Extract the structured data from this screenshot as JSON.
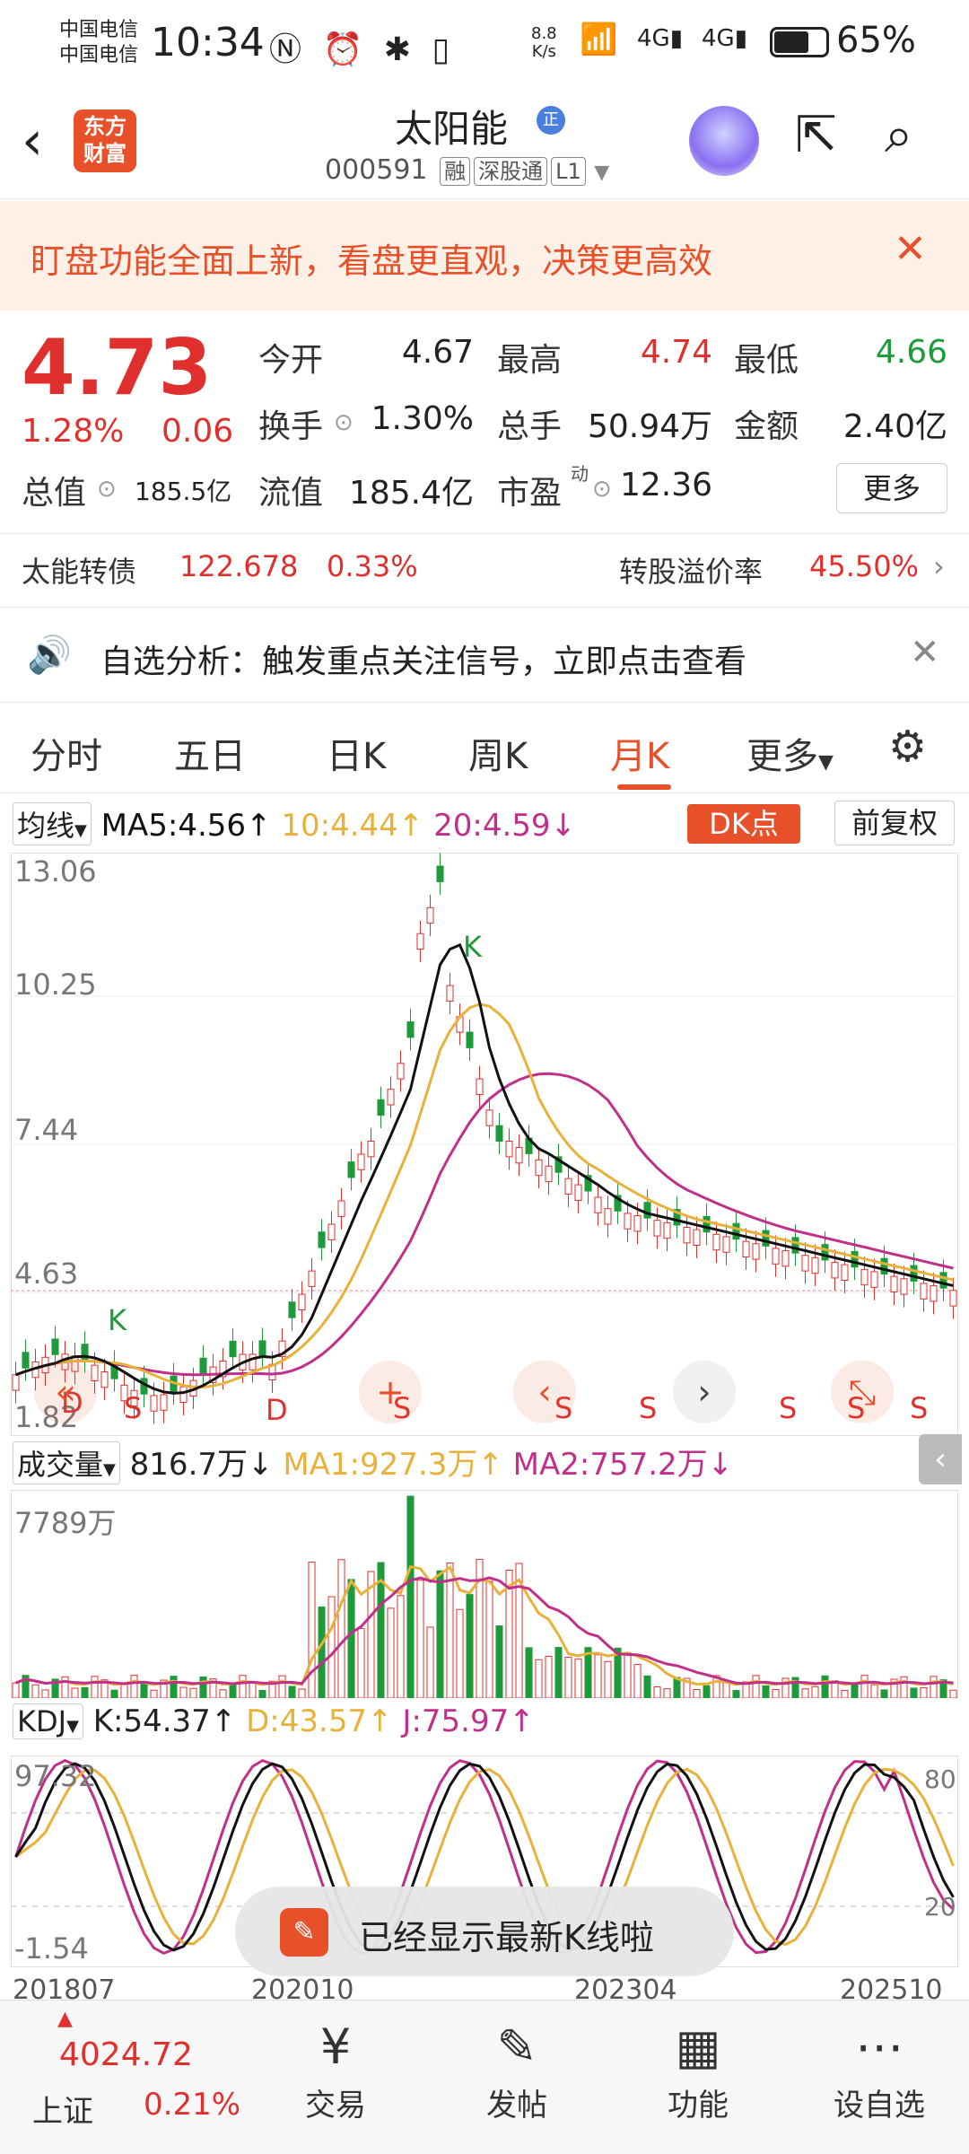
{
  "status": {
    "carrier1": "中国电信",
    "carrier2": "中国电信",
    "time": "10:34",
    "netspeed_value": "8.8",
    "netspeed_unit": "K/s",
    "battery": "65%"
  },
  "nav": {
    "title": "太阳能",
    "zheng": "正",
    "code": "000591",
    "tags": [
      "融",
      "深股通",
      "L1"
    ],
    "logo_line1": "东方",
    "logo_line2": "财富"
  },
  "banner": {
    "text": "盯盘功能全面上新，看盘更直观，决策更高效"
  },
  "quote": {
    "price": "4.73",
    "change_pct": "1.28%",
    "change_amt": "0.06",
    "open_label": "今开",
    "open": "4.67",
    "high_label": "最高",
    "high": "4.74",
    "low_label": "最低",
    "low": "4.66",
    "turnover_label": "换手",
    "turnover": "1.30%",
    "volume_label": "总手",
    "volume": "50.94万",
    "amount_label": "金额",
    "amount": "2.40亿",
    "mktcap_label": "总值",
    "mktcap": "185.5亿",
    "float_label": "流值",
    "float": "185.4亿",
    "pe_label": "市盈",
    "pe_sup": "动",
    "pe": "12.36",
    "more": "更多"
  },
  "bond": {
    "name": "太能转债",
    "price": "122.678",
    "pct": "0.33%",
    "premium_label": "转股溢价率",
    "premium": "45.50%"
  },
  "notice": {
    "text": "自选分析：触发重点关注信号，立即点击查看"
  },
  "tabs": [
    "分时",
    "五日",
    "日K",
    "周K",
    "月K",
    "更多"
  ],
  "active_tab": "月K",
  "ma_row": {
    "selector": "均线",
    "ma5": "MA5:4.56",
    "ma10": "10:4.44",
    "ma20": "20:4.59",
    "dk": "DK点",
    "fq": "前复权"
  },
  "price_axis": [
    "13.06",
    "10.25",
    "7.44",
    "4.63",
    "1.82"
  ],
  "markers": {
    "k": "K",
    "s": "S",
    "d": "D"
  },
  "vol_row": {
    "selector": "成交量",
    "value": "816.7万",
    "ma1": "MA1:927.3万",
    "ma2": "MA2:757.2万",
    "max": "7789万"
  },
  "kdj_row": {
    "selector": "KDJ",
    "k": "K:54.37",
    "d": "D:43.57",
    "j": "J:75.97",
    "max": "97.32",
    "min": "-1.54",
    "r80": "80",
    "r20": "20"
  },
  "toast": {
    "text": "已经显示最新K线啦"
  },
  "x_dates": [
    "201807",
    "202010",
    "202304",
    "202510"
  ],
  "bottom": {
    "index_value": "4024.72",
    "index_name": "上证",
    "index_pct": "0.21%",
    "items": [
      "交易",
      "发帖",
      "功能",
      "设自选"
    ]
  },
  "colors": {
    "accent": "#e8502a",
    "up": "#e0302e",
    "down": "#1f9a3a",
    "ma5": "#111111",
    "ma10": "#e8b23a",
    "ma20": "#c0308a"
  }
}
